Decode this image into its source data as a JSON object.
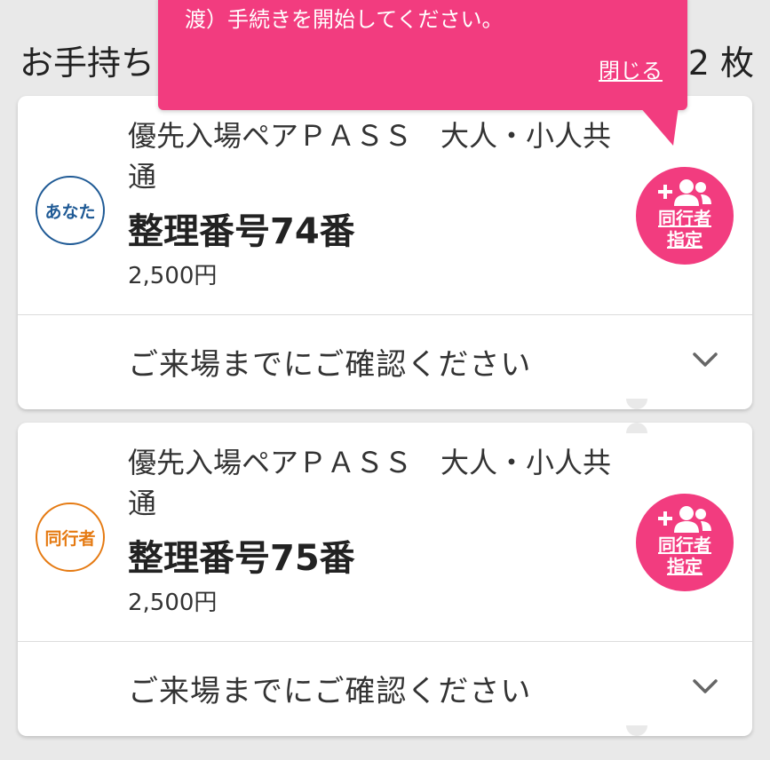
{
  "header": {
    "title": "お手持ち",
    "count": "2 枚"
  },
  "tooltip": {
    "message": "渡）手続きを開始してください。",
    "close_label": "閉じる"
  },
  "tickets": [
    {
      "badge": "あなた",
      "name": "優先入場ペアＰＡＳＳ　大人・小人共通",
      "number": "整理番号74番",
      "price": "2,500円",
      "assign_label_1": "同行者",
      "assign_label_2": "指定",
      "confirm": "ご来場までにご確認ください"
    },
    {
      "badge": "同行者",
      "name": "優先入場ペアＰＡＳＳ　大人・小人共通",
      "number": "整理番号75番",
      "price": "2,500円",
      "assign_label_1": "同行者",
      "assign_label_2": "指定",
      "confirm": "ご来場までにご確認ください"
    }
  ],
  "colors": {
    "accent": "#f23c7f",
    "badge_you": "#1f5a95",
    "badge_companion": "#e57a12"
  },
  "icons": {
    "assign": "add-people-icon",
    "expand": "chevron-down-icon"
  }
}
